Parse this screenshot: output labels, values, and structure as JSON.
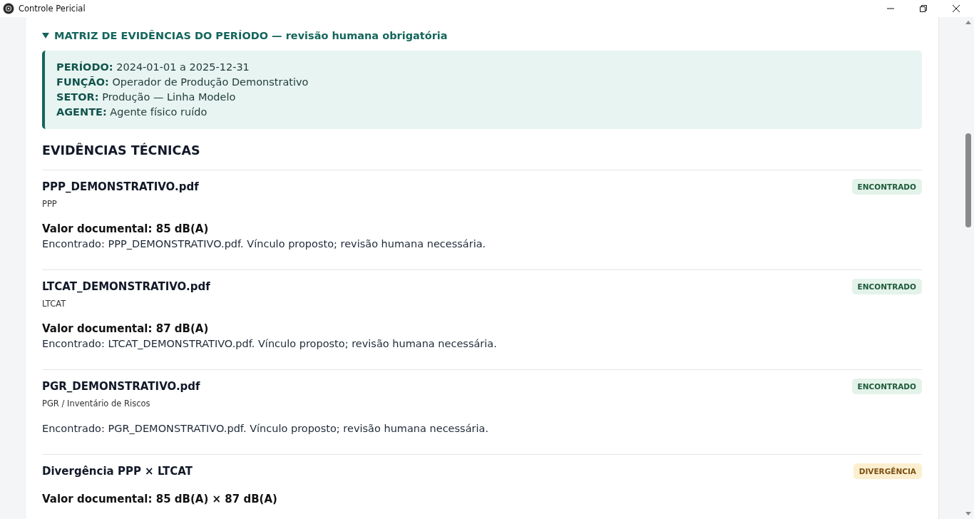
{
  "window": {
    "title": "Controle Pericial"
  },
  "matrix": {
    "expanded": true,
    "heading": "MATRIZ DE EVIDÊNCIAS DO PERÍODO — revisão humana obrigatória",
    "fields": [
      {
        "label": "PERÍODO:",
        "value": "2024-01-01 a 2025-12-31"
      },
      {
        "label": "FUNÇÃO:",
        "value": "Operador de Produção Demonstrativo"
      },
      {
        "label": "SETOR:",
        "value": "Produção — Linha Modelo"
      },
      {
        "label": "AGENTE:",
        "value": "Agente físico ruído"
      }
    ]
  },
  "evidence": {
    "heading": "EVIDÊNCIAS TÉCNICAS",
    "items": [
      {
        "title": "PPP_DEMONSTRATIVO.pdf",
        "subtitle": "PPP",
        "kind": "found",
        "badge": "ENCONTRADO",
        "value": "Valor documental: 85 dB(A)",
        "note": "Encontrado: PPP_DEMONSTRATIVO.pdf. Vínculo proposto; revisão humana necessária."
      },
      {
        "title": "LTCAT_DEMONSTRATIVO.pdf",
        "subtitle": "LTCAT",
        "kind": "found",
        "badge": "ENCONTRADO",
        "value": "Valor documental: 87 dB(A)",
        "note": "Encontrado: LTCAT_DEMONSTRATIVO.pdf. Vínculo proposto; revisão humana necessária."
      },
      {
        "title": "PGR_DEMONSTRATIVO.pdf",
        "subtitle": "PGR / Inventário de Riscos",
        "kind": "found",
        "badge": "ENCONTRADO",
        "note": "Encontrado: PGR_DEMONSTRATIVO.pdf. Vínculo proposto; revisão humana necessária."
      },
      {
        "title": "Divergência PPP × LTCAT",
        "kind": "divergence",
        "badge": "DIVERGÊNCIA",
        "value": "Valor documental: 85 dB(A) × 87 dB(A)"
      }
    ]
  }
}
